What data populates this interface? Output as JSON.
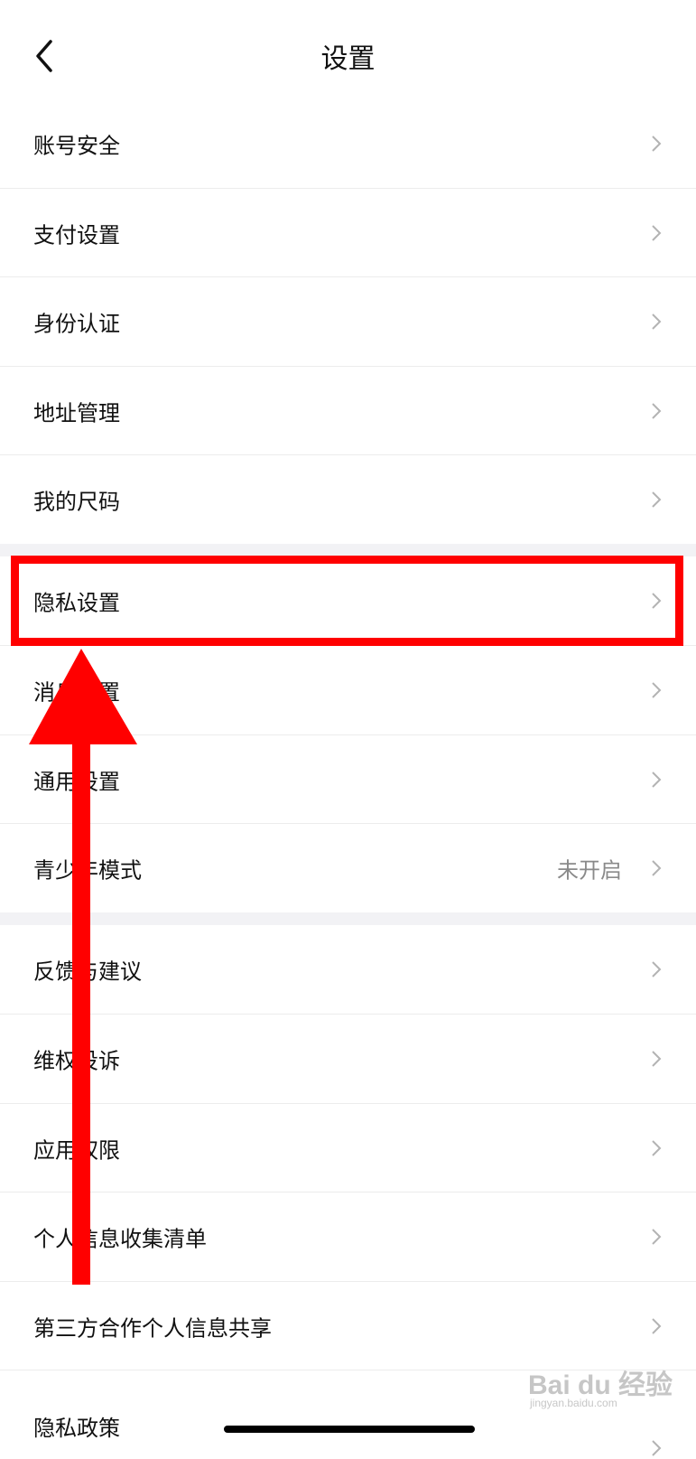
{
  "header": {
    "title": "设置",
    "back_icon": "chevron-left-icon"
  },
  "groups": [
    {
      "items": [
        {
          "label": "账号安全",
          "icon": "chevron-right-icon"
        },
        {
          "label": "支付设置",
          "icon": "chevron-right-icon"
        },
        {
          "label": "身份认证",
          "icon": "chevron-right-icon"
        },
        {
          "label": "地址管理",
          "icon": "chevron-right-icon"
        },
        {
          "label": "我的尺码",
          "icon": "chevron-right-icon"
        }
      ]
    },
    {
      "items": [
        {
          "label": "隐私设置",
          "icon": "chevron-right-icon"
        },
        {
          "label": "消息设置",
          "icon": "chevron-right-icon"
        },
        {
          "label": "通用设置",
          "icon": "chevron-right-icon"
        },
        {
          "label": "青少年模式",
          "value": "未开启",
          "icon": "chevron-right-icon"
        }
      ]
    },
    {
      "items": [
        {
          "label": "反馈与建议",
          "icon": "chevron-right-icon"
        },
        {
          "label": "维权投诉",
          "icon": "chevron-right-icon"
        },
        {
          "label": "应用权限",
          "icon": "chevron-right-icon"
        },
        {
          "label": "个人信息收集清单",
          "icon": "chevron-right-icon"
        },
        {
          "label": "第三方合作个人信息共享",
          "icon": "chevron-right-icon"
        },
        {
          "label": "隐私政策",
          "icon": "chevron-right-icon"
        }
      ]
    }
  ],
  "annotation": {
    "highlight_color": "#ff0000",
    "arrow_color": "#ff0000"
  },
  "watermark": {
    "brand": "Bai du 经验",
    "url": "jingyan.baidu.com"
  },
  "colors": {
    "background": "#ffffff",
    "group_gap": "#f2f2f5",
    "text": "#111111",
    "secondary_text": "#8a8a8a",
    "chevron": "#b3b3b3"
  }
}
